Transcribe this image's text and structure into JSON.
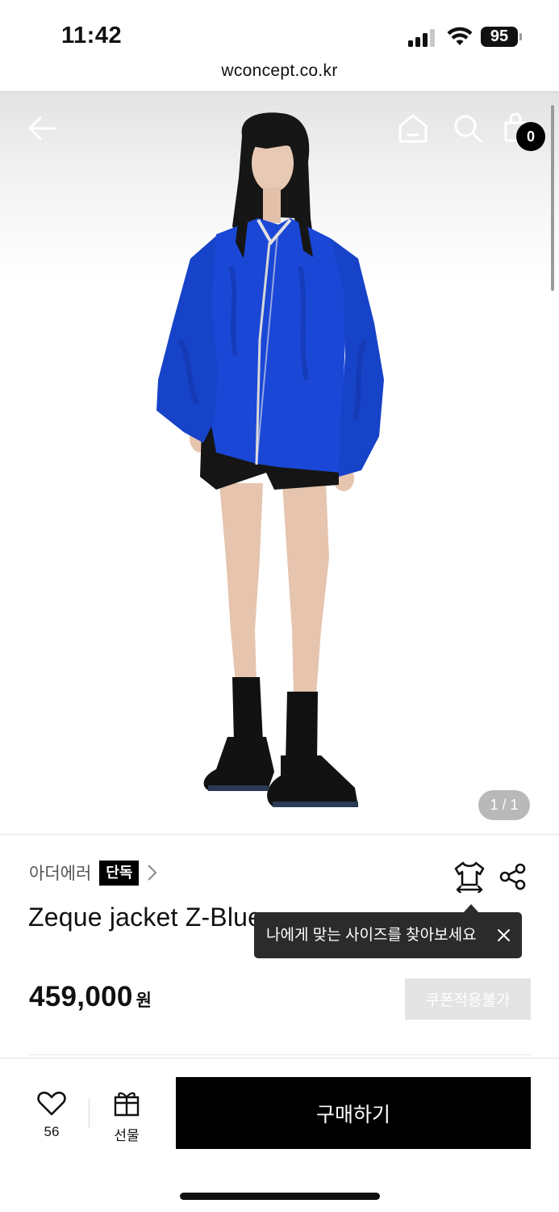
{
  "status_bar": {
    "time": "11:42",
    "battery": "95"
  },
  "browser": {
    "url": "wconcept.co.kr"
  },
  "top_nav": {
    "back_icon": "arrow-left-icon",
    "home_icon": "home-icon",
    "search_icon": "search-icon",
    "cart_icon": "shopping-bag-icon",
    "cart_count": "0"
  },
  "gallery": {
    "indicator": "1 / 1",
    "image": "model-wearing-blue-jacket",
    "jacket_color": "#1a47d6"
  },
  "product": {
    "brand": "아더에러",
    "badge": "단독",
    "title": "Zeque jacket Z-Blue",
    "price": "459,000",
    "currency": "원",
    "coupon_label": "쿠폰적용불가"
  },
  "tooltip": {
    "text": "나에게 맞는 사이즈를 찾아보세요"
  },
  "bottom_bar": {
    "like_count": "56",
    "gift_label": "선물",
    "buy_label": "구매하기"
  },
  "colors": {
    "accent": "#000000",
    "badge_bg": "#000000",
    "tooltip_bg": "#2b2b2b",
    "coupon_bg": "#e4e4e4"
  }
}
